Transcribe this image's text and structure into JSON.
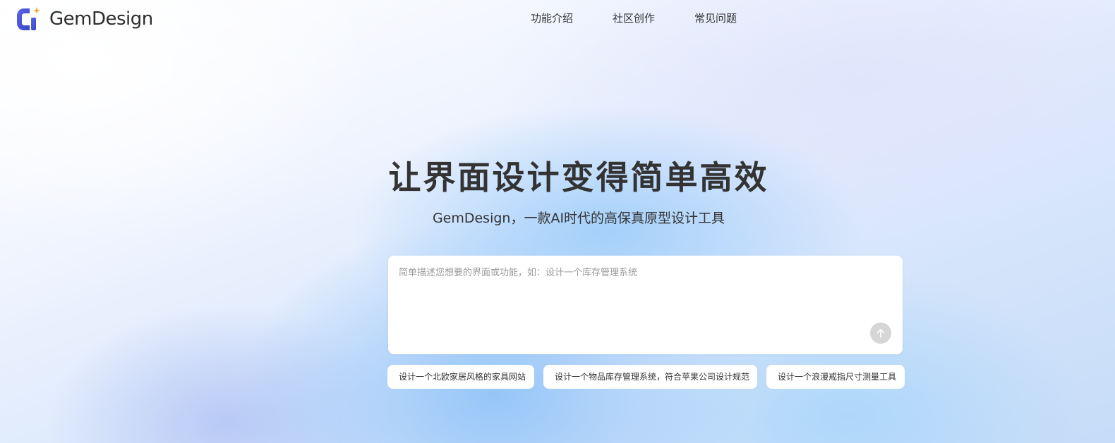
{
  "brand": {
    "name": "GemDesign",
    "logo_icon": "gemdesign-logo-icon",
    "accent_color": "#4f5bd5",
    "sparkle_color": "#f2a93b"
  },
  "nav": {
    "items": [
      {
        "label": "功能介绍"
      },
      {
        "label": "社区创作"
      },
      {
        "label": "常见问题"
      }
    ]
  },
  "hero": {
    "title": "让界面设计变得简单高效",
    "subtitle": "GemDesign，一款AI时代的高保真原型设计工具"
  },
  "prompt": {
    "placeholder": "简单描述您想要的界面或功能，如：设计一个库存管理系统",
    "value": "",
    "send_icon": "arrow-up-icon",
    "send_button_color": "#d6d6d6"
  },
  "suggestions": [
    {
      "label": "设计一个北欧家居风格的家具网站"
    },
    {
      "label": "设计一个物品库存管理系统，符合苹果公司设计规范"
    },
    {
      "label": "设计一个浪漫戒指尺寸测量工具"
    }
  ]
}
